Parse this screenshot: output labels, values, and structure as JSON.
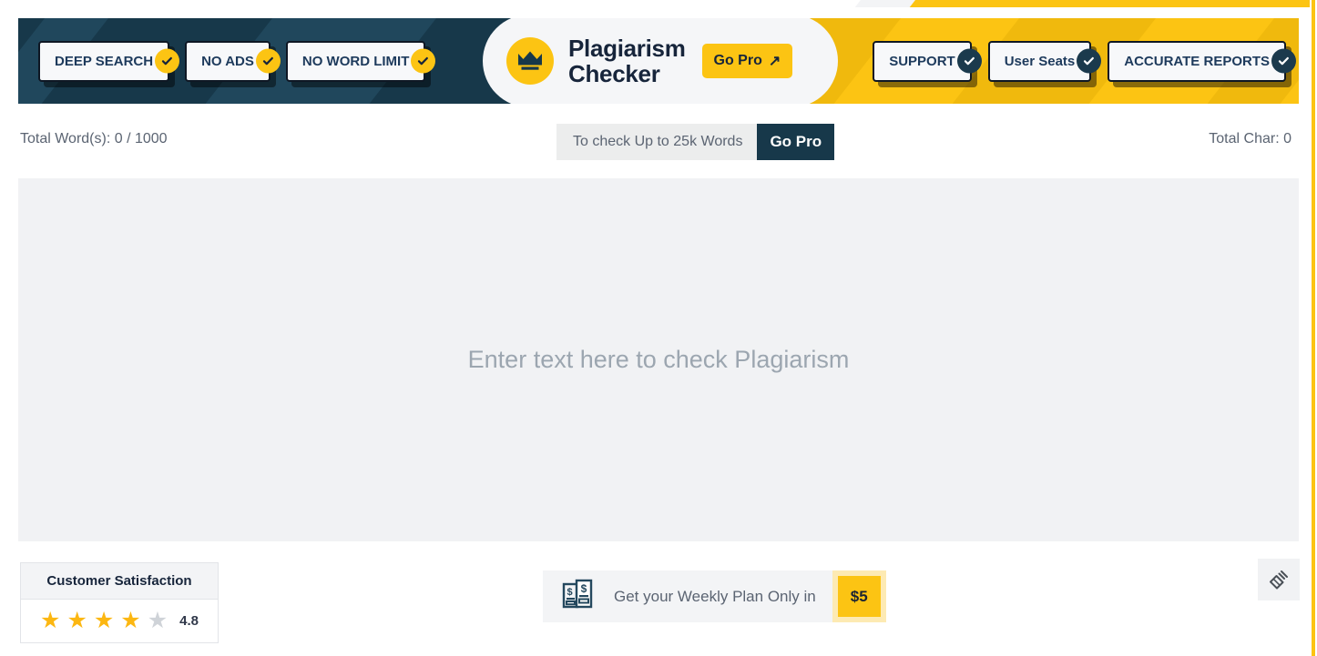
{
  "header": {
    "logo": {
      "icon": "crown-icon",
      "title": "Plagiarism\nChecker",
      "go_pro_label": "Go Pro",
      "go_pro_arrow": "↗"
    },
    "left_pills": [
      {
        "label": "DEEP SEARCH",
        "check": "check-icon"
      },
      {
        "label": "NO ADS",
        "check": "check-icon"
      },
      {
        "label": "NO WORD LIMIT",
        "check": "check-icon"
      }
    ],
    "right_pills": [
      {
        "label": "SUPPORT",
        "check": "check-icon"
      },
      {
        "label": "User Seats",
        "check": "check-icon"
      },
      {
        "label": "ACCURATE REPORTS",
        "check": "check-icon"
      }
    ],
    "colors": {
      "navy": "#17384a",
      "yellow": "#fcc413",
      "pill_border": "#0e1724"
    }
  },
  "stats": {
    "total_words": "Total Word(s): 0 / 1000",
    "total_chars": "Total Char: 0",
    "upsell_text": "To check Up to 25k Words",
    "upsell_button": "Go Pro"
  },
  "editor": {
    "placeholder": "Enter text here to check Plagiarism",
    "value": ""
  },
  "footer": {
    "satisfaction": {
      "title": "Customer Satisfaction",
      "rating": "4.8",
      "stars_filled": 4,
      "stars_total": 5
    },
    "plan": {
      "icon": "money-bills-icon",
      "text": "Get your Weekly Plan Only in",
      "price": "$5"
    },
    "erase": {
      "icon": "eraser-icon"
    }
  }
}
